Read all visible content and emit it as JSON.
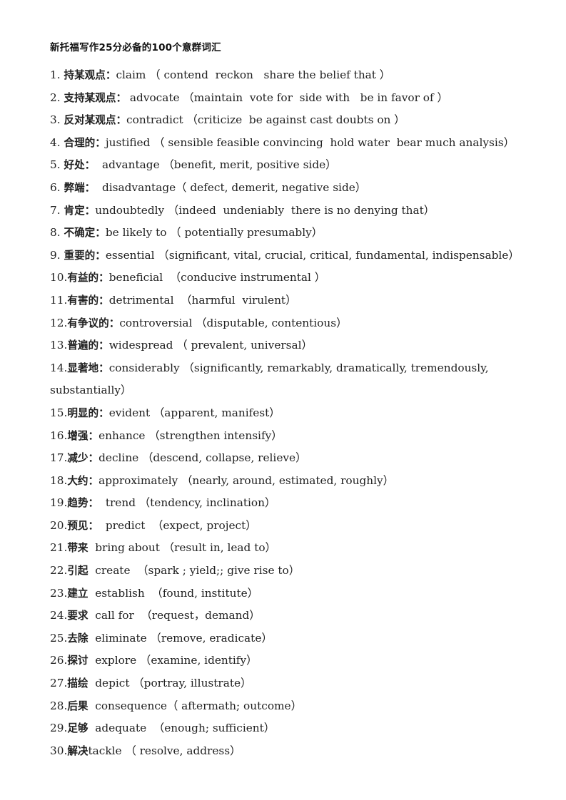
{
  "document": {
    "title": "新托福写作25分必备的100个意群词汇",
    "page_background": "#ffffff",
    "text_color": "#202020"
  },
  "entries": [
    {
      "num": "1. ",
      "cn": "持某观点：",
      "en": "claim （ contend  reckon   share the belief that ）"
    },
    {
      "num": "2. ",
      "cn": "支持某观点：",
      "en": " advocate （maintain  vote for  side with   be in favor of ）"
    },
    {
      "num": "3. ",
      "cn": "反对某观点：",
      "en": "contradict （criticize  be against cast doubts on ）"
    },
    {
      "num": "4. ",
      "cn": "合理的：",
      "en": "justified （ sensible feasible convincing  hold water  bear much analysis）"
    },
    {
      "num": "5. ",
      "cn": "好处：",
      "en": "  advantage （benefit, merit, positive side）"
    },
    {
      "num": "6. ",
      "cn": "弊端：",
      "en": "  disadvantage（ defect, demerit, negative side）"
    },
    {
      "num": "7. ",
      "cn": "肯定：",
      "en": "undoubtedly （indeed  undeniably  there is no denying that）"
    },
    {
      "num": "8. ",
      "cn": "不确定：",
      "en": "be likely to （ potentially presumably）"
    },
    {
      "num": "9. ",
      "cn": "重要的：",
      "en": "essential （significant, vital, crucial, critical, fundamental, indispensable）"
    },
    {
      "num": "10.",
      "cn": "有益的：",
      "en": "beneficial  （conducive instrumental ）"
    },
    {
      "num": "11.",
      "cn": "有害的：",
      "en": "detrimental  （harmful  virulent）"
    },
    {
      "num": "12.",
      "cn": "有争议的：",
      "en": "controversial （disputable, contentious）"
    },
    {
      "num": "13.",
      "cn": "普遍的：",
      "en": "widespread （ prevalent, universal）"
    },
    {
      "num": "14.",
      "cn": "显著地：",
      "en": "considerably （significantly, remarkably, dramatically, tremendously, substantially）"
    },
    {
      "num": "15.",
      "cn": "明显的：",
      "en": "evident （apparent, manifest）"
    },
    {
      "num": "16.",
      "cn": "增强：",
      "en": "enhance （strengthen intensify）"
    },
    {
      "num": "17.",
      "cn": "减少：",
      "en": "decline （descend, collapse, relieve）"
    },
    {
      "num": "18.",
      "cn": "大约：",
      "en": "approximately （nearly, around, estimated, roughly）"
    },
    {
      "num": "19.",
      "cn": "趋势：",
      "en": "  trend （tendency, inclination）"
    },
    {
      "num": "20.",
      "cn": "预见：",
      "en": "  predict  （expect, project）"
    },
    {
      "num": "21.",
      "cn": "带来",
      "en": "  bring about （result in, lead to）"
    },
    {
      "num": "22.",
      "cn": "引起",
      "en": "  create  （spark ; yield;; give rise to）"
    },
    {
      "num": "23.",
      "cn": "建立",
      "en": "  establish  （found, institute）"
    },
    {
      "num": "24.",
      "cn": "要求",
      "en": "  call for  （request，demand）"
    },
    {
      "num": "25.",
      "cn": "去除",
      "en": "  eliminate （remove, eradicate）"
    },
    {
      "num": "26.",
      "cn": "探讨",
      "en": "  explore （examine, identify）"
    },
    {
      "num": "27.",
      "cn": "描绘",
      "en": "  depict （portray, illustrate）"
    },
    {
      "num": "28.",
      "cn": "后果",
      "en": "  consequence（ aftermath; outcome）"
    },
    {
      "num": "29.",
      "cn": "足够",
      "en": "  adequate  （enough; sufficient）"
    },
    {
      "num": "30.",
      "cn": "解决",
      "en": "tackle （ resolve, address）"
    }
  ]
}
